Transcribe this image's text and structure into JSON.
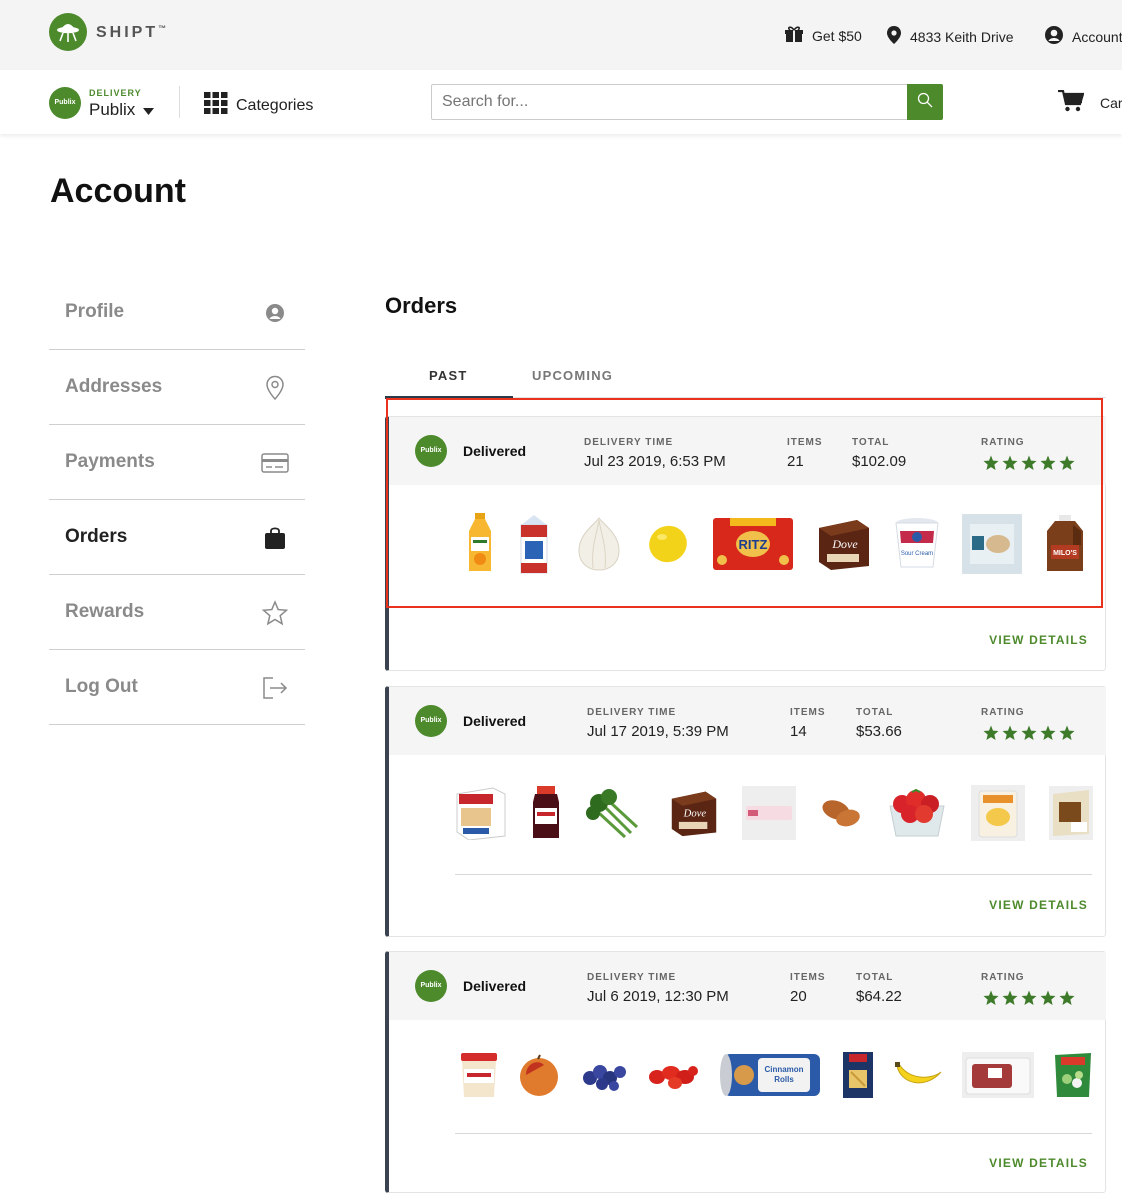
{
  "brand": {
    "name": "SHIPT",
    "tm": "™",
    "green": "#4d8a2c"
  },
  "topnav": {
    "promo": {
      "label": "Get $50",
      "icon": "gift-icon"
    },
    "address": {
      "label": "4833 Keith Drive",
      "icon": "location-pin-icon"
    },
    "account": {
      "label": "Account",
      "icon": "user-circle-icon"
    }
  },
  "storebar": {
    "store_logo": "Publix",
    "delivery_label": "DELIVERY",
    "store_name": "Publix",
    "categories_label": "Categories",
    "search_placeholder": "Search for...",
    "cart_label": "Cart"
  },
  "page": {
    "title": "Account"
  },
  "sidebar": {
    "items": [
      {
        "label": "Profile",
        "icon": "user-icon",
        "active": false
      },
      {
        "label": "Addresses",
        "icon": "location-pin-icon",
        "active": false
      },
      {
        "label": "Payments",
        "icon": "credit-card-icon",
        "active": false
      },
      {
        "label": "Orders",
        "icon": "shopping-bag-icon",
        "active": true
      },
      {
        "label": "Rewards",
        "icon": "star-icon",
        "active": false
      },
      {
        "label": "Log Out",
        "icon": "logout-icon",
        "active": false
      }
    ]
  },
  "orders": {
    "title": "Orders",
    "tabs": [
      {
        "label": "PAST",
        "active": true
      },
      {
        "label": "UPCOMING",
        "active": false
      }
    ],
    "labels": {
      "delivery_time": "DELIVERY TIME",
      "items": "ITEMS",
      "total": "TOTAL",
      "rating": "RATING",
      "view_details": "VIEW DETAILS"
    },
    "list": [
      {
        "store_logo": "Publix",
        "status": "Delivered",
        "delivery_time": "Jul 23 2019, 6:53 PM",
        "items": "21",
        "total": "$102.09",
        "rating": 5,
        "products": [
          {
            "name": "orange-juice",
            "icon": "juice-bottle-icon"
          },
          {
            "name": "milk-carton",
            "icon": "milk-carton-icon"
          },
          {
            "name": "onion",
            "icon": "onion-icon"
          },
          {
            "name": "lemon",
            "icon": "lemon-icon"
          },
          {
            "name": "ritz-crackers",
            "icon": "cracker-box-icon",
            "text": "RITZ"
          },
          {
            "name": "dove-ice-cream-bars",
            "icon": "ice-cream-box-icon",
            "text": "Dove"
          },
          {
            "name": "sour-cream",
            "icon": "sour-cream-tub-icon"
          },
          {
            "name": "packaged-food",
            "icon": "package-icon"
          },
          {
            "name": "iced-tea-jug",
            "icon": "jug-icon"
          }
        ]
      },
      {
        "store_logo": "Publix",
        "status": "Delivered",
        "delivery_time": "Jul 17 2019, 5:39 PM",
        "items": "14",
        "total": "$53.66",
        "rating": 5,
        "products": [
          {
            "name": "quaker-bars",
            "icon": "cereal-box-icon"
          },
          {
            "name": "jam-jar",
            "icon": "jam-jar-icon"
          },
          {
            "name": "broccolini",
            "icon": "broccoli-icon"
          },
          {
            "name": "dove-ice-cream-bars",
            "icon": "ice-cream-box-icon",
            "text": "Dove"
          },
          {
            "name": "pink-package",
            "icon": "package-icon"
          },
          {
            "name": "sweet-potatoes",
            "icon": "sweet-potato-icon"
          },
          {
            "name": "strawberries",
            "icon": "strawberry-icon"
          },
          {
            "name": "shredded-cheese",
            "icon": "cheese-bag-icon"
          },
          {
            "name": "packaged-item",
            "icon": "package-icon"
          }
        ]
      },
      {
        "store_logo": "Publix",
        "status": "Delivered",
        "delivery_time": "Jul 6 2019, 12:30 PM",
        "items": "20",
        "total": "$64.22",
        "rating": 5,
        "products": [
          {
            "name": "frosting-tub",
            "icon": "tub-icon"
          },
          {
            "name": "peach",
            "icon": "peach-icon"
          },
          {
            "name": "blueberries",
            "icon": "blueberry-icon"
          },
          {
            "name": "grape-tomatoes",
            "icon": "tomato-icon"
          },
          {
            "name": "cinnamon-rolls",
            "icon": "dough-can-icon"
          },
          {
            "name": "barilla-pasta",
            "icon": "pasta-box-icon"
          },
          {
            "name": "banana",
            "icon": "banana-icon"
          },
          {
            "name": "ground-beef",
            "icon": "meat-tray-icon"
          },
          {
            "name": "frozen-vegetables",
            "icon": "frozen-bag-icon"
          }
        ]
      }
    ]
  },
  "highlight_color": "#e8321d",
  "star_color": "#3d7a2a"
}
